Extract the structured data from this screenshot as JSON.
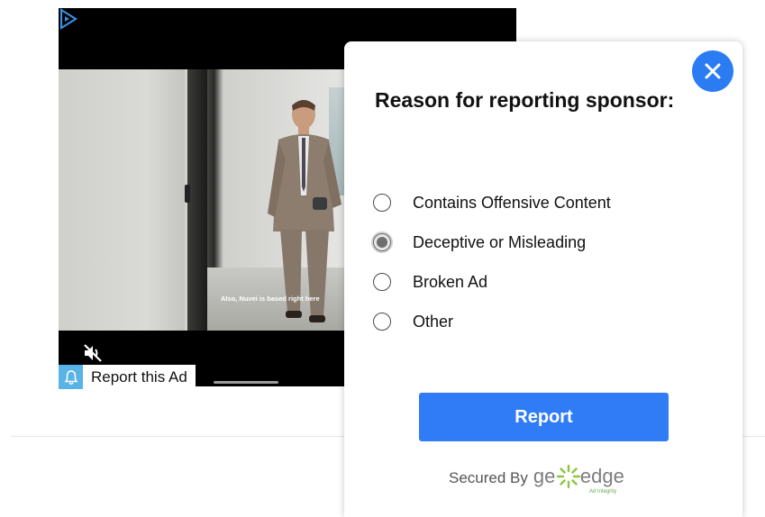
{
  "player": {
    "caption": "Also, Nuvei is based right here",
    "report_ad_label": "Report this Ad",
    "icons": [
      "play-badge-icon",
      "volume-mute-icon",
      "bell-icon"
    ]
  },
  "dialog": {
    "title": "Reason for reporting sponsor:",
    "close_icon": "close-icon",
    "options": [
      {
        "label": "Contains Offensive Content",
        "selected": false
      },
      {
        "label": "Deceptive or Misleading",
        "selected": true
      },
      {
        "label": "Broken Ad",
        "selected": false
      },
      {
        "label": "Other",
        "selected": false
      }
    ],
    "report_label": "Report",
    "secured_by": "Secured By",
    "brand": {
      "ge": "ge",
      "edge": "edge",
      "tagline": "Ad Integrity"
    }
  },
  "colors": {
    "accent": "#2f7cf6",
    "close": "#2b7cf3",
    "bell_bg": "#5ab3e6",
    "brand_green": "#6aa84f"
  }
}
